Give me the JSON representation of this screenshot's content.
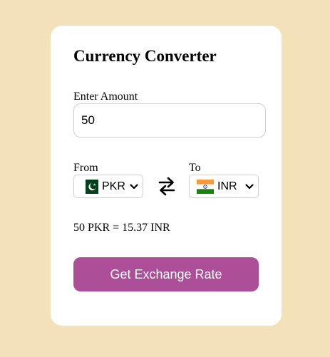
{
  "converter": {
    "title": "Currency Converter",
    "amount_label": "Enter Amount",
    "amount_value": "50",
    "from_label": "From",
    "to_label": "To",
    "from_currency": "PKR",
    "to_currency": "INR",
    "from_flag_icon": "pakistan-flag-icon",
    "to_flag_icon": "india-flag-icon",
    "swap_icon": "swap-arrows-icon",
    "result_text": "50 PKR = 15.37 INR",
    "button_label": "Get Exchange Rate"
  },
  "colors": {
    "page_background": "#f3e2b9",
    "card_background": "#ffffff",
    "button_background": "#ad4e99",
    "button_text": "#ffffff",
    "pakistan_green": "#01411c",
    "india_saffron": "#ff9933",
    "india_green": "#138808",
    "india_chakra": "#000080"
  }
}
